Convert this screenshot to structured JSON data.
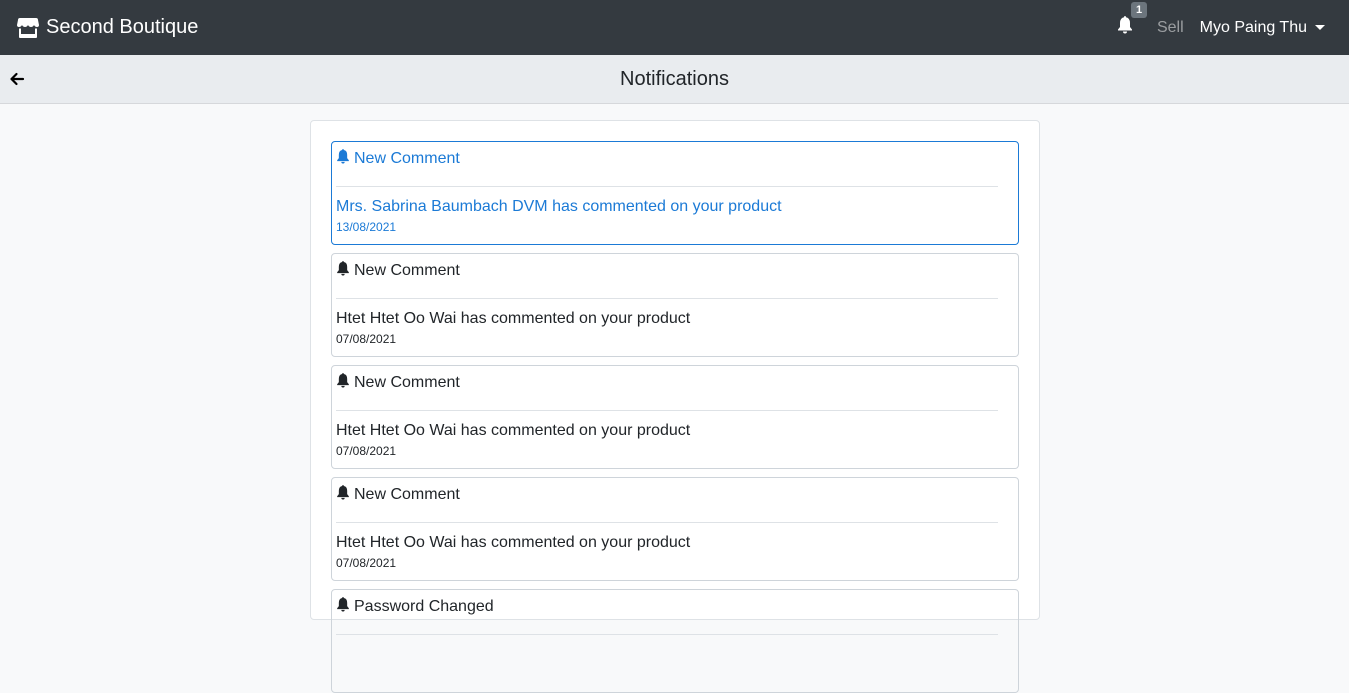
{
  "navbar": {
    "brand": "Second Boutique",
    "notification_count": "1",
    "sell_label": "Sell",
    "user_name": "Myo Paing Thu"
  },
  "page": {
    "title": "Notifications"
  },
  "notifications": [
    {
      "title": "New Comment",
      "message": "Mrs. Sabrina Baumbach DVM has commented on your product",
      "date": "13/08/2021",
      "unread": true
    },
    {
      "title": "New Comment",
      "message": "Htet Htet Oo Wai has commented on your product",
      "date": "07/08/2021",
      "unread": false
    },
    {
      "title": "New Comment",
      "message": "Htet Htet Oo Wai has commented on your product",
      "date": "07/08/2021",
      "unread": false
    },
    {
      "title": "New Comment",
      "message": "Htet Htet Oo Wai has commented on your product",
      "date": "07/08/2021",
      "unread": false
    },
    {
      "title": "Password Changed",
      "message": "",
      "date": "",
      "unread": false
    }
  ],
  "colors": {
    "navbar_bg": "#343a40",
    "accent": "#1b7ad6"
  }
}
